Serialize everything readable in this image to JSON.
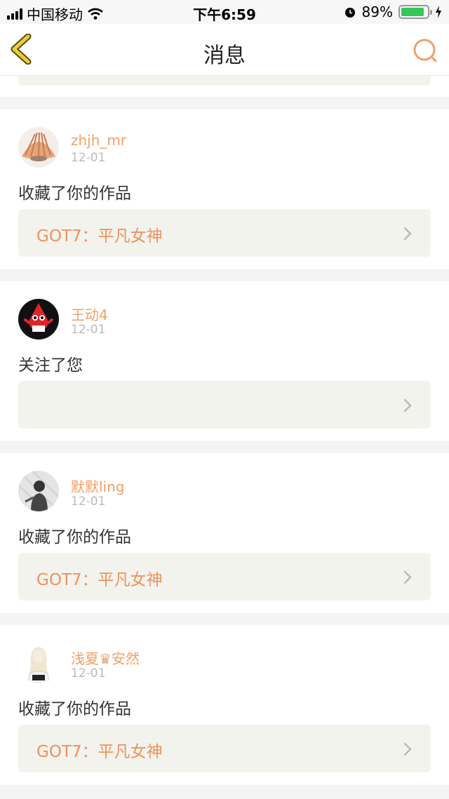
{
  "status_bar": {
    "carrier": "中国移动",
    "time": "下午6:59",
    "battery_percent": "89%",
    "battery_level": 0.89
  },
  "nav": {
    "title": "消息"
  },
  "messages": [
    {
      "username": "zhjh_mr",
      "date": "12-01",
      "action": "收藏了你的作品",
      "work_title": "GOT7：平凡女神"
    },
    {
      "username": "王动4",
      "date": "12-01",
      "action": "关注了您",
      "work_title": ""
    },
    {
      "username": "默默ling",
      "date": "12-01",
      "action": "收藏了你的作品",
      "work_title": "GOT7：平凡女神"
    },
    {
      "username": "浅夏♛安然",
      "date": "12-01",
      "action": "收藏了你的作品",
      "work_title": "GOT7：平凡女神"
    }
  ],
  "colors": {
    "accent": "#f0a06a",
    "back_icon": "#e8cf3a",
    "link_bg": "#f3f3ee"
  },
  "icons": [
    "signal-icon",
    "wifi-icon",
    "alarm-icon",
    "battery-icon",
    "charging-icon",
    "back-arrow-icon",
    "search-icon",
    "chevron-right-icon"
  ]
}
